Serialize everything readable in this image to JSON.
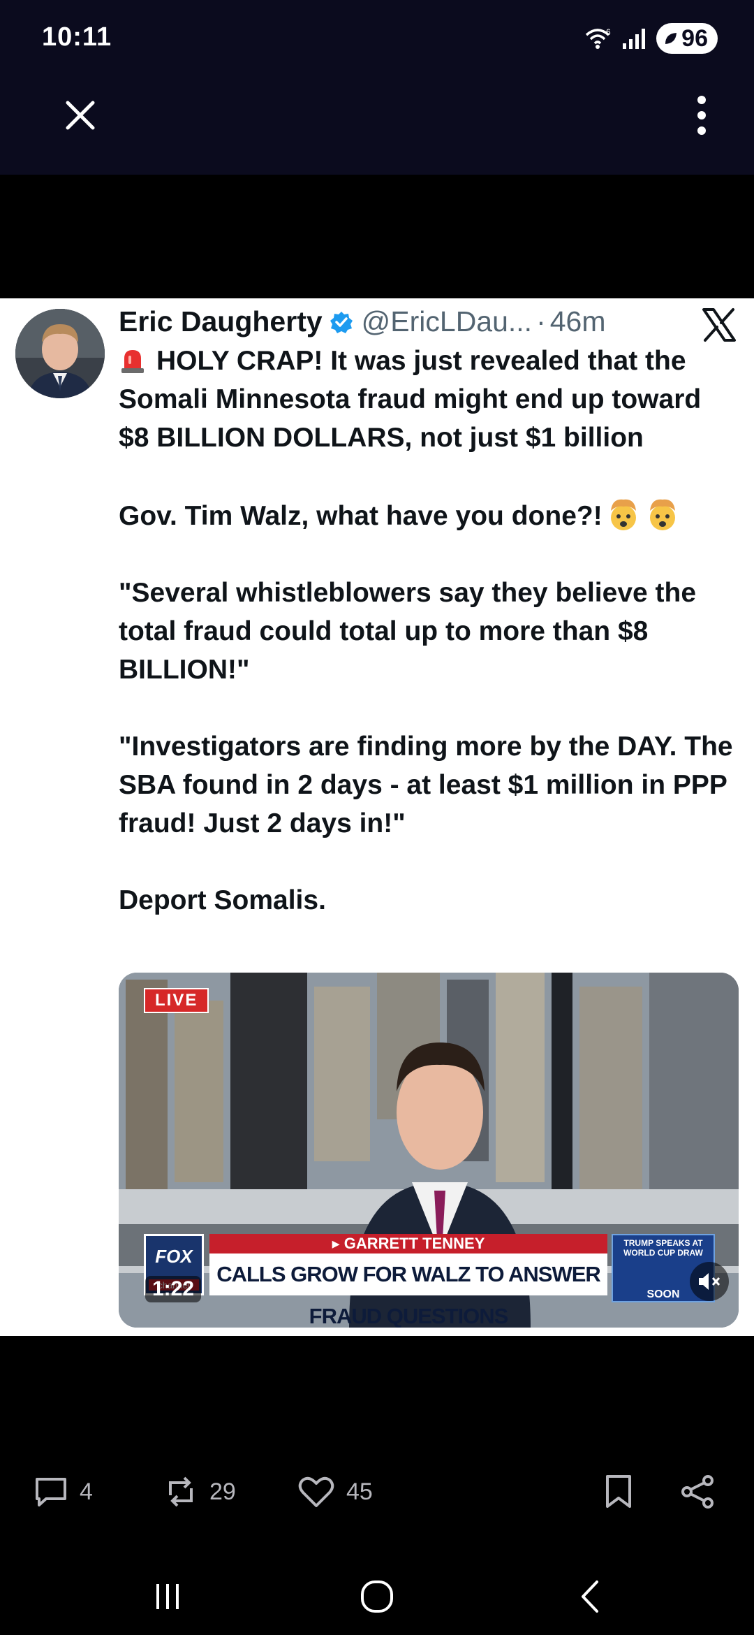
{
  "status_bar": {
    "time": "10:11",
    "battery": "96",
    "network": "6"
  },
  "top_bar": {
    "close_icon": "close-icon",
    "menu_icon": "more-vertical-icon"
  },
  "tweet": {
    "author_name": "Eric Daugherty",
    "handle": "@EricLDau...",
    "separator": "·",
    "time": "46m",
    "platform_icon": "x-logo",
    "paragraphs": [
      "HOLY CRAP! It was just revealed that the Somali Minnesota fraud might end up toward $8 BILLION DOLLARS, not just $1 billion",
      "Gov. Tim Walz, what have you done?!",
      "\"Several whistleblowers say they believe the total fraud could total up to more than $8 BILLION!\"",
      "\"Investigators are finding more by the DAY. The SBA found in 2 days - at least $1 million in PPP fraud! Just 2 days in!\"",
      "Deport Somalis."
    ],
    "video": {
      "live_badge": "LIVE",
      "reporter": "▸ GARRETT TENNEY",
      "headline": "CALLS GROW FOR WALZ TO ANSWER FRAUD QUESTIONS",
      "network": "FOX",
      "network_sub": "channel",
      "promo": "TRUMP SPEAKS AT WORLD CUP DRAW",
      "promo_when": "SOON",
      "duration": "1:22"
    }
  },
  "actions": {
    "replies": "4",
    "reposts": "29",
    "likes": "45"
  },
  "colors": {
    "top_bg": "#0b0b1e",
    "verified": "#1d9bf0",
    "action_icon": "#b7b7bd"
  }
}
